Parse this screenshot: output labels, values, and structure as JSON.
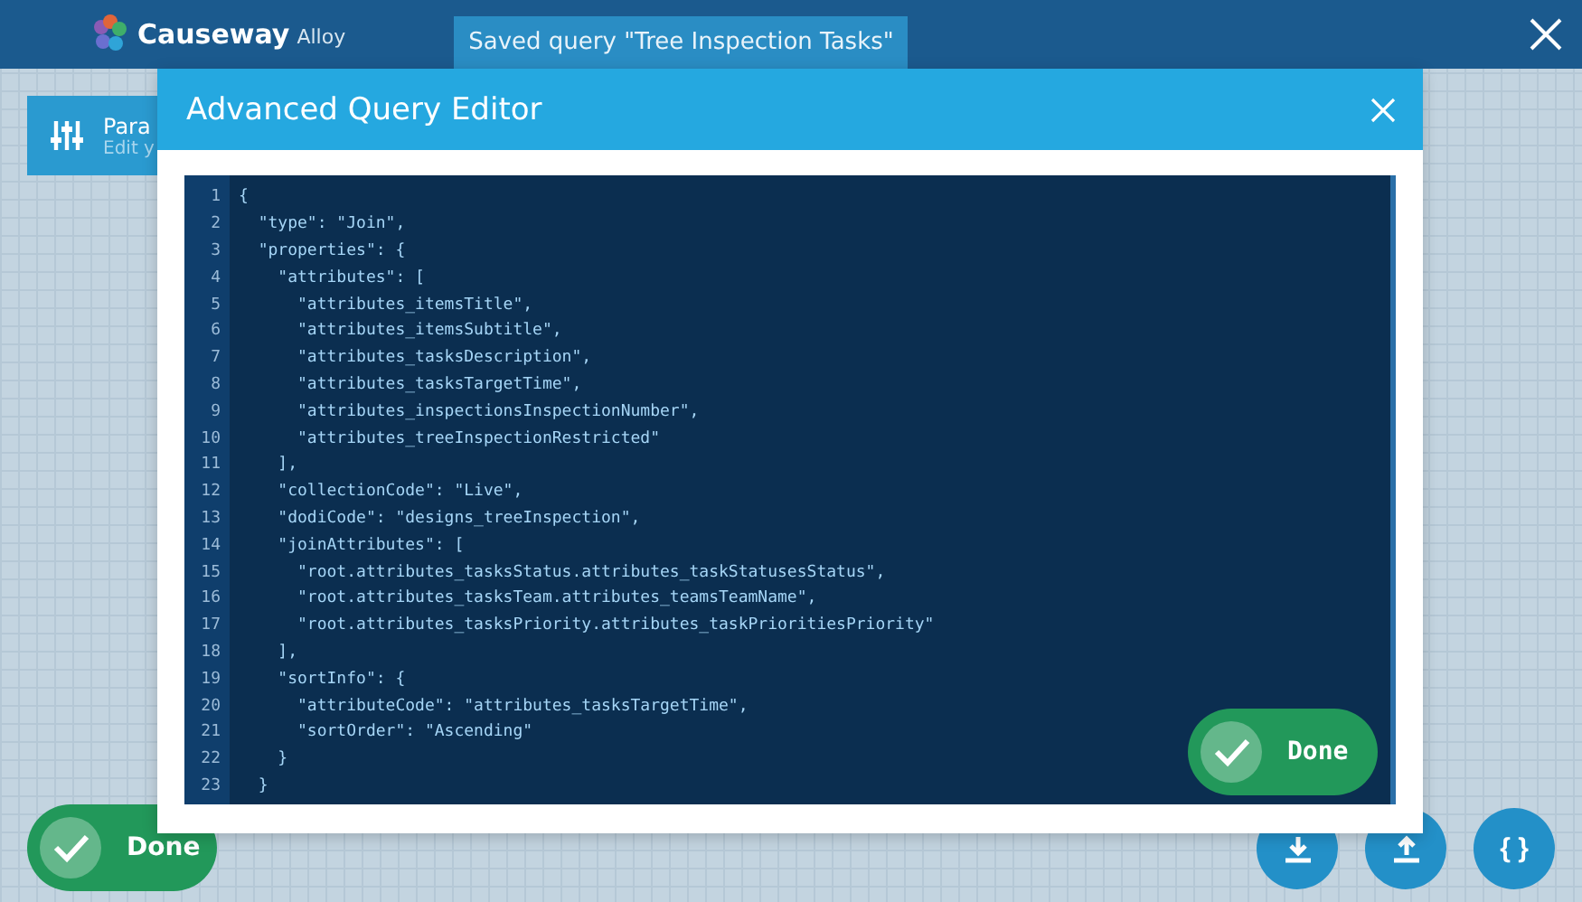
{
  "header": {
    "logo": {
      "brand": "Causeway",
      "product": "Alloy"
    },
    "tab": {
      "label": "Saved query \"Tree Inspection Tasks\"",
      "selected": true
    }
  },
  "parameters_card": {
    "title": "Para",
    "subtitle": "Edit y"
  },
  "done_button": {
    "label": "Done"
  },
  "actions": [
    {
      "kind": "download"
    },
    {
      "kind": "upload"
    },
    {
      "kind": "braces",
      "label": "{ }"
    }
  ],
  "dialog": {
    "title": "Advanced Query Editor",
    "lines": [
      {
        "number": "1",
        "text": "{"
      },
      {
        "number": "2",
        "text": "  \"type\": \"Join\","
      },
      {
        "number": "3",
        "text": "  \"properties\": {"
      },
      {
        "number": "4",
        "text": "    \"attributes\": ["
      },
      {
        "number": "5",
        "text": "      \"attributes_itemsTitle\","
      },
      {
        "number": "6",
        "text": "      \"attributes_itemsSubtitle\","
      },
      {
        "number": "7",
        "text": "      \"attributes_tasksDescription\","
      },
      {
        "number": "8",
        "text": "      \"attributes_tasksTargetTime\","
      },
      {
        "number": "9",
        "text": "      \"attributes_inspectionsInspectionNumber\","
      },
      {
        "number": "10",
        "text": "      \"attributes_treeInspectionRestricted\""
      },
      {
        "number": "11",
        "text": "    ],"
      },
      {
        "number": "12",
        "text": "    \"collectionCode\": \"Live\","
      },
      {
        "number": "13",
        "text": "    \"dodiCode\": \"designs_treeInspection\","
      },
      {
        "number": "14",
        "text": "    \"joinAttributes\": ["
      },
      {
        "number": "15",
        "text": "      \"root.attributes_tasksStatus.attributes_taskStatusesStatus\","
      },
      {
        "number": "16",
        "text": "      \"root.attributes_tasksTeam.attributes_teamsTeamName\","
      },
      {
        "number": "17",
        "text": "      \"root.attributes_tasksPriority.attributes_taskPrioritiesPriority\""
      },
      {
        "number": "18",
        "text": "    ],"
      },
      {
        "number": "19",
        "text": "    \"sortInfo\": {"
      },
      {
        "number": "20",
        "text": "      \"attributeCode\": \"attributes_tasksTargetTime\","
      },
      {
        "number": "21",
        "text": "      \"sortOrder\": \"Ascending\""
      },
      {
        "number": "22",
        "text": "    }"
      },
      {
        "number": "23",
        "text": "  }"
      }
    ],
    "done_button": {
      "label": "Done"
    }
  }
}
